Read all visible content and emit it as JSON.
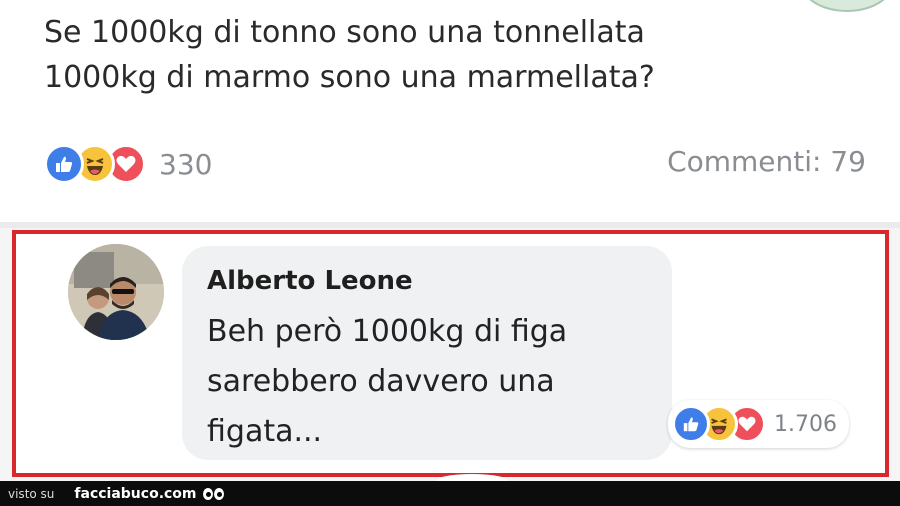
{
  "post": {
    "text_lines": [
      "Se 1000kg di tonno sono una tonnellata",
      "1000kg di marmo sono una marmellata?"
    ],
    "reactions": {
      "icons": [
        "like-icon",
        "haha-icon",
        "love-icon"
      ],
      "count": "330"
    },
    "comments_label": "Commenti: 79"
  },
  "comment": {
    "author": "Alberto Leone",
    "text_lines": [
      "Beh però 1000kg di figa",
      "sarebbero davvero una",
      "figata..."
    ],
    "reactions": {
      "icons": [
        "like-icon",
        "haha-icon",
        "love-icon"
      ],
      "count": "1.706"
    }
  },
  "footer": {
    "visto": "visto su",
    "brand": "facciabuco.com"
  },
  "colors": {
    "highlight_border": "#d8272d",
    "like": "#3f7ee8",
    "haha": "#f7c33c",
    "love": "#ef4f5a",
    "muted_text": "#8a8d91"
  }
}
